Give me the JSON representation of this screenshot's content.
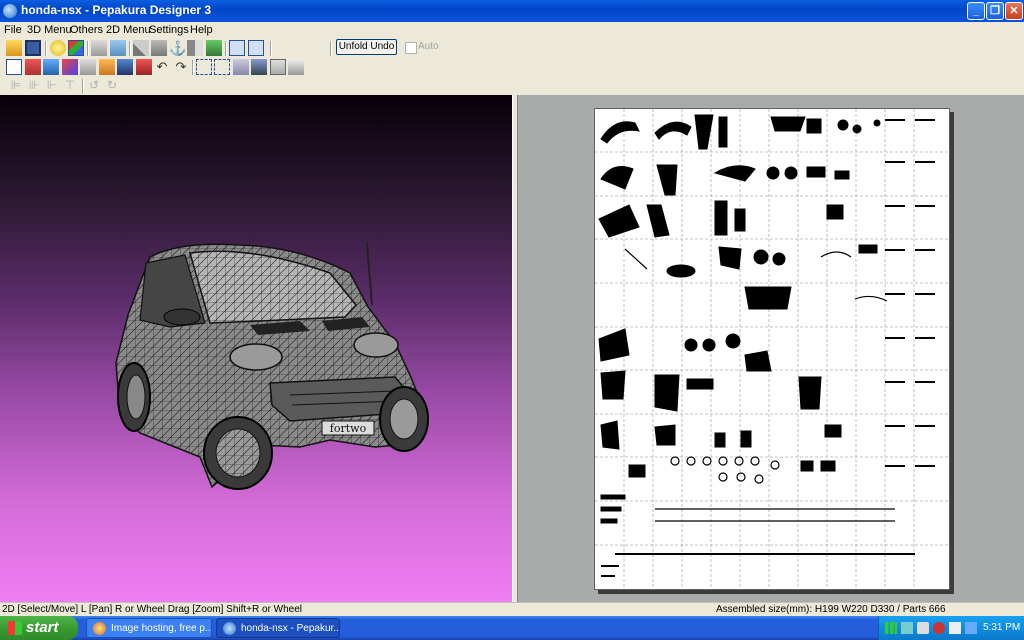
{
  "window": {
    "title": "honda-nsx - Pepakura Designer 3"
  },
  "menu": [
    "File",
    "3D Menu",
    "Others",
    "2D Menu",
    "Settings",
    "Help"
  ],
  "toolbar": {
    "unfold_undo": "Unfold Undo",
    "auto_label": "Auto"
  },
  "viewer3d": {
    "plate_text": "fortwo"
  },
  "status": {
    "left": "2D [Select/Move] L [Pan] R or Wheel Drag [Zoom] Shift+R or Wheel",
    "right": "Assembled size(mm): H199 W220 D330 / Parts 666"
  },
  "taskbar": {
    "start": "start",
    "tasks": [
      "Image hosting, free p...",
      "honda-nsx - Pepakur..."
    ],
    "clock": "5:31 PM"
  },
  "colors": {
    "titlebar": "#0a53d8",
    "taskbar": "#245edb",
    "start": "#389b32",
    "view3d_top": "#080008",
    "view3d_bottom": "#f07ef4"
  }
}
